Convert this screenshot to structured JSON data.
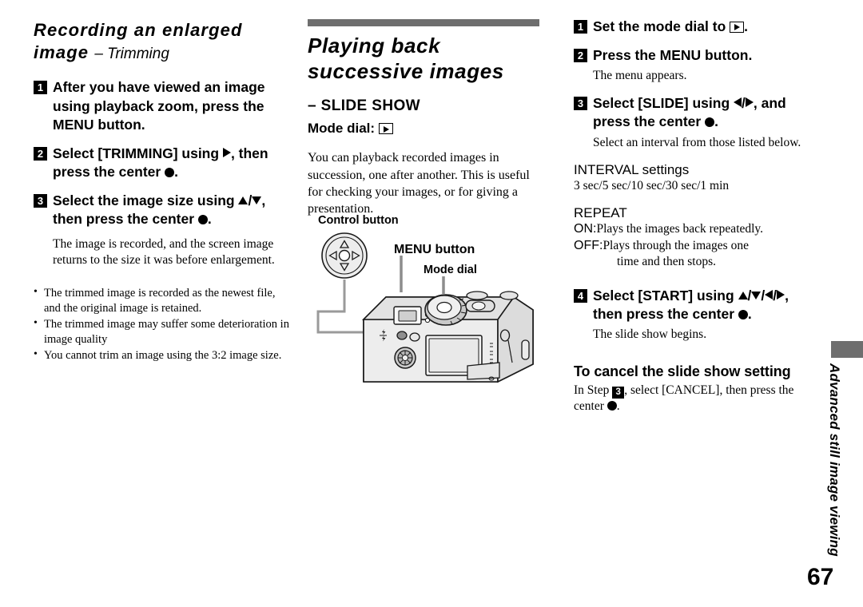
{
  "page": {
    "number": "67",
    "side_tab_text": "Advanced still image viewing"
  },
  "left_column": {
    "heading_line1": "Recording an enlarged",
    "heading_line2_bold": "image",
    "heading_line2_sub": "– Trimming",
    "steps": [
      {
        "num": "1",
        "text_parts": [
          "After you have viewed an image using playback zoom, press the MENU button."
        ]
      },
      {
        "num": "2",
        "text_before": "Select [TRIMMING] using ",
        "icon1": "triangle-right-icon",
        "text_mid": ", then press the center ",
        "icon2": "filled-circle-icon",
        "text_after": "."
      },
      {
        "num": "3",
        "text_before": "Select the image size using ",
        "icon1": "triangle-up-icon",
        "text_mid": "/",
        "icon2": "triangle-down-icon",
        "text_after": ", then press the center ",
        "icon3": "filled-circle-icon",
        "text_end": "."
      }
    ],
    "step3_body": "The image is recorded, and the screen image returns to the size it was before enlargement.",
    "bullets": [
      "The trimmed image is recorded as the newest file, and the original image is retained.",
      "The trimmed image may suffer some deterioration in image quality",
      "You cannot trim an image using the 3:2 image size."
    ]
  },
  "middle_column": {
    "heading_line1": "Playing back",
    "heading_line2": "successive images",
    "subtitle": "– SLIDE SHOW",
    "mode_dial_label": "Mode dial:",
    "mode_dial_icon": "playback-box-icon",
    "intro_paragraph": "You can playback recorded images in succession, one after another. This is useful for checking your images, or for giving a presentation.",
    "figure": {
      "label_control_button": "Control button",
      "label_menu_button": "MENU button",
      "label_mode_dial": "Mode dial",
      "alt": "Illustration of a digital camera back showing the control button, MENU button and mode dial"
    }
  },
  "right_column": {
    "steps": [
      {
        "num": "1",
        "text_before": "Set the mode dial to ",
        "icon": "playback-box-icon",
        "text_after": "."
      },
      {
        "num": "2",
        "text": "Press the MENU button.",
        "body": "The menu appears."
      },
      {
        "num": "3",
        "text_before": "Select [SLIDE] using ",
        "icon1": "triangle-left-icon",
        "sep": "/",
        "icon2": "triangle-right-icon",
        "text_mid": ", and press the center ",
        "icon3": "filled-circle-icon",
        "text_after": ".",
        "body": "Select an interval from those listed below."
      },
      {
        "num": "4",
        "text_before": "Select [START] using ",
        "icon1": "triangle-up-icon",
        "icon2": "triangle-down-icon",
        "icon3": "triangle-left-icon",
        "icon4": "triangle-right-icon",
        "text_mid": ", then press the center ",
        "icon5": "filled-circle-icon",
        "text_after": ".",
        "body": "The slide show begins."
      }
    ],
    "interval_heading": "INTERVAL settings",
    "interval_values": "3 sec/5 sec/10 sec/30 sec/1 min",
    "repeat_heading": "REPEAT",
    "repeat_on_key": "ON:",
    "repeat_on_value": "Plays the images back repeatedly.",
    "repeat_off_key": "OFF:",
    "repeat_off_value_line1": "Plays through the images one",
    "repeat_off_value_line2": "time and then stops.",
    "cancel_heading": "To cancel the slide show setting",
    "cancel_text_before": "In Step ",
    "cancel_step_num": "3",
    "cancel_text_mid": ", select [CANCEL], then press the center ",
    "cancel_icon": "filled-circle-icon",
    "cancel_text_after": "."
  },
  "colors": {
    "grey_bar": "#6e6e6e",
    "text": "#000000",
    "background": "#ffffff"
  }
}
